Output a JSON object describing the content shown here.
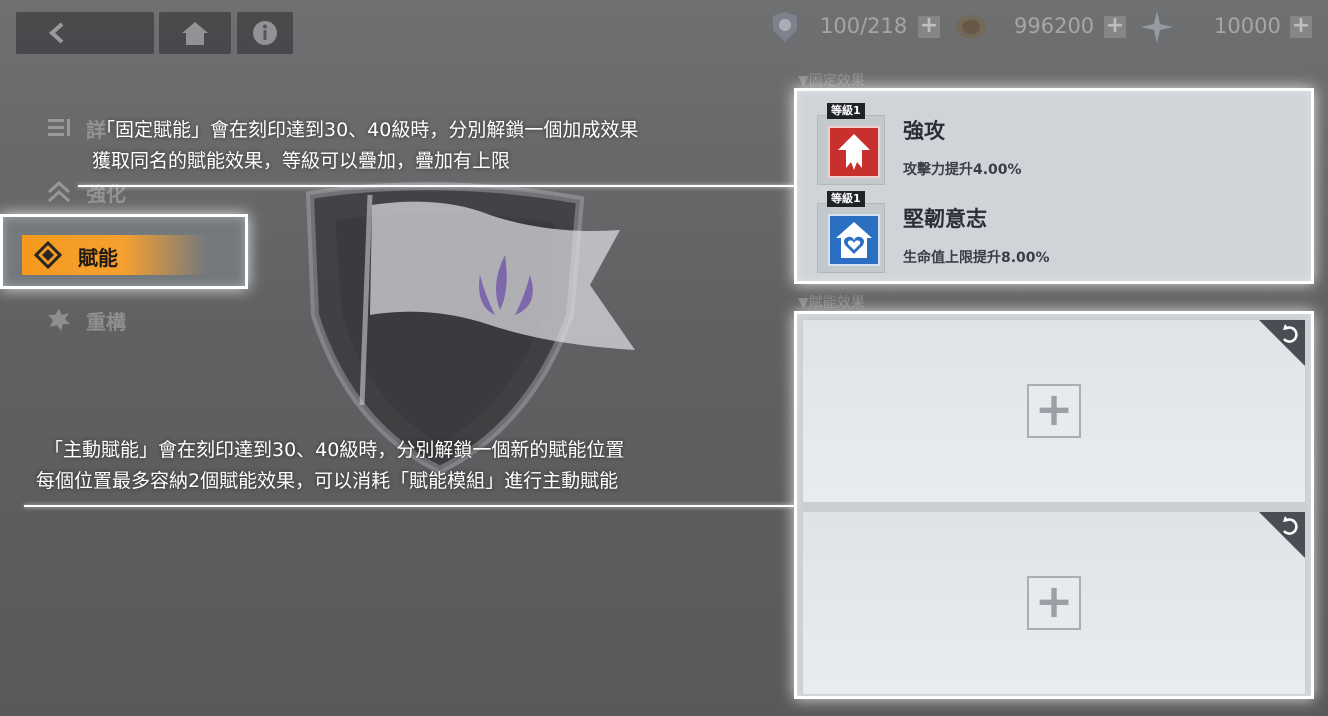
{
  "resources": [
    {
      "name": "stamina",
      "icon": "badge-icon",
      "value": "100/218"
    },
    {
      "name": "coins",
      "icon": "coin-icon",
      "value": "996200"
    },
    {
      "name": "crystal",
      "icon": "crystal-icon",
      "value": "10000"
    }
  ],
  "sidebar": {
    "items": [
      {
        "label": "詳",
        "icon": "list-icon"
      },
      {
        "label": "強化",
        "icon": "upgrade-chevrons-icon"
      },
      {
        "label": "賦能",
        "icon": "empower-icon",
        "active": true
      },
      {
        "label": "重構",
        "icon": "restructure-icon"
      }
    ]
  },
  "sections": {
    "fixed_label": "▼固定效果",
    "empower_label": "▼賦能效果"
  },
  "fixed_effects": [
    {
      "level": "等級1",
      "name": "強攻",
      "desc": "攻擊力提升4.00%",
      "color": "#c8302e"
    },
    {
      "level": "等級1",
      "name": "堅韌意志",
      "desc": "生命值上限提升8.00%",
      "color": "#2b6fc2"
    }
  ],
  "callouts": {
    "top_line1": "「固定賦能」會在刻印達到30、40級時，分別解鎖一個加成效果",
    "top_line2": "獲取同名的賦能效果，等級可以疊加，疊加有上限",
    "bottom_line1": "「主動賦能」會在刻印達到30、40級時，分別解鎖一個新的賦能位置",
    "bottom_line2": "每個位置最多容納2個賦能效果，可以消耗「賦能模組」進行主動賦能"
  },
  "slots": [
    {
      "plus": "+"
    },
    {
      "plus": "+"
    }
  ],
  "colors": {
    "accent_orange": "#f39a1d",
    "highlight": "#ffffff"
  }
}
